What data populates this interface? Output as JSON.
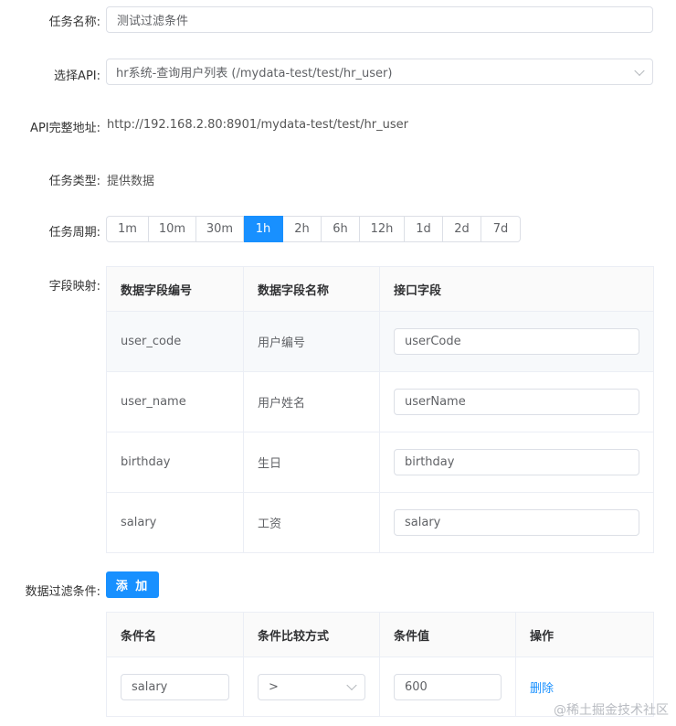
{
  "form": {
    "task_name": {
      "label": "任务名称:",
      "value": "测试过滤条件"
    },
    "api_select": {
      "label": "选择API:",
      "value": "hr系统-查询用户列表 (/mydata-test/test/hr_user)"
    },
    "api_url": {
      "label": "API完整地址:",
      "value": "http://192.168.2.80:8901/mydata-test/test/hr_user"
    },
    "task_type": {
      "label": "任务类型:",
      "value": "提供数据"
    },
    "task_period": {
      "label": "任务周期:",
      "options": [
        "1m",
        "10m",
        "30m",
        "1h",
        "2h",
        "6h",
        "12h",
        "1d",
        "2d",
        "7d"
      ],
      "selected": "1h"
    }
  },
  "field_mapping": {
    "label": "字段映射:",
    "headers": [
      "数据字段编号",
      "数据字段名称",
      "接口字段"
    ],
    "rows": [
      {
        "code": "user_code",
        "name": "用户编号",
        "api_field": "userCode"
      },
      {
        "code": "user_name",
        "name": "用户姓名",
        "api_field": "userName"
      },
      {
        "code": "birthday",
        "name": "生日",
        "api_field": "birthday"
      },
      {
        "code": "salary",
        "name": "工资",
        "api_field": "salary"
      }
    ]
  },
  "filter": {
    "label": "数据过滤条件:",
    "add_button": "添 加",
    "headers": [
      "条件名",
      "条件比较方式",
      "条件值",
      "操作"
    ],
    "rows": [
      {
        "name": "salary",
        "operator": ">",
        "value": "600",
        "action": "删除"
      }
    ]
  },
  "watermark": "@稀土掘金技术社区",
  "colors": {
    "primary": "#1890ff",
    "border": "#dcdfe6"
  }
}
